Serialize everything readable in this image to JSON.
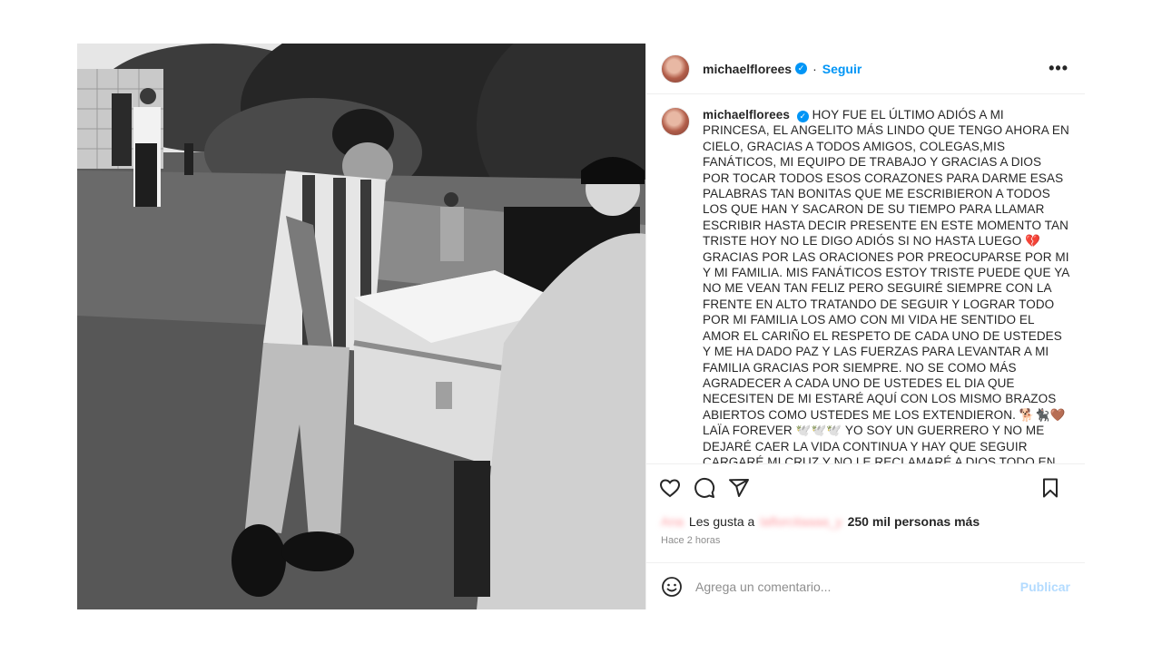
{
  "post": {
    "username": "michaelflorees",
    "verified_mark": "✓",
    "follow_label": "Seguir",
    "more_label": "•••",
    "caption": "HOY FUE EL ÚLTIMO ADIÓS A MI PRINCESA, EL ANGELITO MÁS LINDO QUE TENGO AHORA EN CIELO, GRACIAS A TODOS AMIGOS, COLEGAS,MIS FANÁTICOS, MI EQUIPO DE TRABAJO Y GRACIAS A DIOS POR TOCAR TODOS ESOS CORAZONES PARA DARME ESAS PALABRAS TAN BONITAS QUE ME ESCRIBIERON A TODOS LOS QUE HAN Y SACARON DE SU TIEMPO PARA LLAMAR ESCRIBIR HASTA DECIR PRESENTE EN ESTE MOMENTO TAN TRISTE HOY NO LE DIGO ADIÓS SI NO HASTA LUEGO 💔 GRACIAS POR LAS ORACIONES POR PREOCUPARSE POR MI Y MI FAMILIA. MIS FANÁTICOS ESTOY TRISTE PUEDE QUE YA NO ME VEAN TAN FELIZ PERO SEGUIRÉ SIEMPRE CON LA FRENTE EN ALTO TRATANDO DE SEGUIR Y LOGRAR TODO POR MI FAMILIA LOS AMO CON MI VIDA HE SENTIDO EL AMOR EL CARIÑO EL RESPETO DE CADA UNO DE USTEDES Y ME HA DADO PAZ Y LAS FUERZAS PARA LEVANTAR A MI FAMILIA GRACIAS POR SIEMPRE. NO SE COMO MÁS AGRADECER A CADA UNO DE USTEDES EL DIA QUE NECESITEN DE MI ESTARÉ AQUÍ CON LOS MISMO BRAZOS ABIERTOS COMO USTEDES ME LOS EXTENDIERON. 🐕🐈‍⬛🤎 LAÏA FOREVER 🕊️🕊️🕊️ YO SOY UN GUERRERO Y NO ME DEJARÉ CAER LA VIDA CONTINUA Y HAY QUE SEGUIR CARGARÉ MI CRUZ Y NO LE RECLAMARÉ A DIOS TODO EN SUS MANOS Y A SU VOLUNTAD. NO DEJEN DE ORAR POR MI LOS AMOOOOO 🤎🐈‍⬛🐕🙏🏽",
    "likes": {
      "prefix_blurred": "Ana",
      "label": "Les gusta a",
      "user_blurred": "laflorcitaaaa_y",
      "count_text": "250 mil personas más"
    },
    "time_ago": "Hace 2 horas",
    "comment": {
      "placeholder": "Agrega un comentario...",
      "publish_label": "Publicar"
    }
  },
  "icons": [
    "heart-icon",
    "comment-icon",
    "share-icon",
    "bookmark-icon",
    "emoji-icon",
    "more-icon"
  ],
  "colors": {
    "accent": "#0095f6",
    "publish_disabled": "#b3dbff",
    "muted": "#8e8e8e",
    "text": "#262626"
  }
}
